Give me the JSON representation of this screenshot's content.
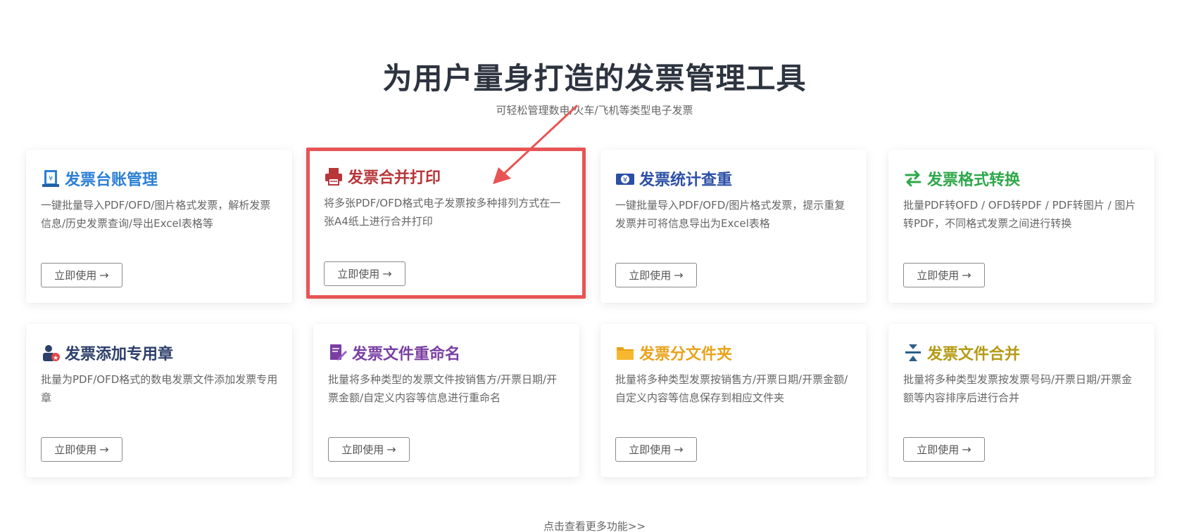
{
  "header": {
    "title": "为用户量身打造的发票管理工具",
    "subtitle": "可轻松管理数电/火车/飞机等类型电子发票"
  },
  "cards": [
    {
      "title": "发票台账管理",
      "desc": "一键批量导入PDF/OFD/图片格式发票，解析发票信息/历史发票查询/导出Excel表格等",
      "button": "立即使用",
      "color": "#2b7fd6",
      "icon": "ledger-icon"
    },
    {
      "title": "发票合并打印",
      "desc": "将多张PDF/OFD格式电子发票按多种排列方式在一张A4纸上进行合并打印",
      "button": "立即使用",
      "color": "#b8363a",
      "icon": "printer-icon"
    },
    {
      "title": "发票统计查重",
      "desc": "一键批量导入PDF/OFD/图片格式发票，提示重复发票并可将信息导出为Excel表格",
      "button": "立即使用",
      "color": "#2c4fa6",
      "icon": "ticket-yen-icon"
    },
    {
      "title": "发票格式转换",
      "desc": "批量PDF转OFD / OFD转PDF / PDF转图片 / 图片转PDF，不同格式发票之间进行转换",
      "button": "立即使用",
      "color": "#2ea84a",
      "icon": "swap-icon"
    },
    {
      "title": "发票添加专用章",
      "desc": "批量为PDF/OFD格式的数电发票文件添加发票专用章",
      "button": "立即使用",
      "color": "#2d3f6a",
      "icon": "stamp-user-icon"
    },
    {
      "title": "发票文件重命名",
      "desc": "批量将多种类型的发票文件按销售方/开票日期/开票金额/自定义内容等信息进行重命名",
      "button": "立即使用",
      "color": "#7a3ea3",
      "icon": "rename-icon"
    },
    {
      "title": "发票分文件夹",
      "desc": "批量将多种类型发票按销售方/开票日期/开票金额/自定义内容等信息保存到相应文件夹",
      "button": "立即使用",
      "color": "#e9a21a",
      "icon": "folder-icon"
    },
    {
      "title": "发票文件合并",
      "desc": "批量将多种类型发票按发票号码/开票日期/开票金额等内容排序后进行合并",
      "button": "立即使用",
      "color": "#b49a14",
      "icon": "merge-icon"
    }
  ],
  "footer": {
    "more_label": "点击查看更多功能>>"
  }
}
